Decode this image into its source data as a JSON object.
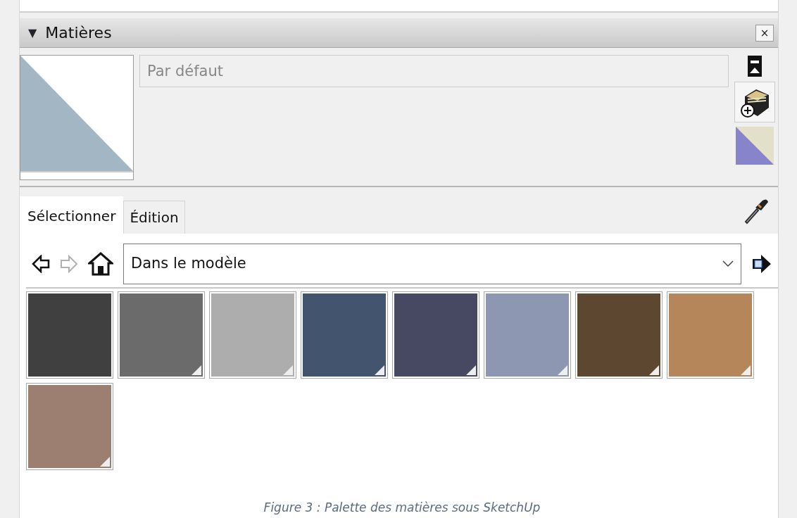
{
  "panel": {
    "toggle": "▼",
    "title": "Matières",
    "close": "×"
  },
  "material_name": {
    "placeholder": "Par défaut"
  },
  "tabs": [
    {
      "label": "Sélectionner",
      "selected": true
    },
    {
      "label": "Édition",
      "selected": false
    }
  ],
  "nav": {
    "back_disabled": false,
    "forward_disabled": true
  },
  "collection": {
    "value": "Dans le modèle"
  },
  "swatches": [
    {
      "color": "#404040",
      "corner_mark": false
    },
    {
      "color": "#6b6b6b",
      "corner_mark": true
    },
    {
      "color": "#adadad",
      "corner_mark": true
    },
    {
      "color": "#43546f",
      "corner_mark": true
    },
    {
      "color": "#474963",
      "corner_mark": true
    },
    {
      "color": "#8e97b2",
      "corner_mark": true
    },
    {
      "color": "#5e4731",
      "corner_mark": true
    },
    {
      "color": "#b4865a",
      "corner_mark": true
    },
    {
      "color": "#9c7f70",
      "corner_mark": true
    }
  ],
  "caption": "Figure 3 : Palette des matières sous SketchUp"
}
